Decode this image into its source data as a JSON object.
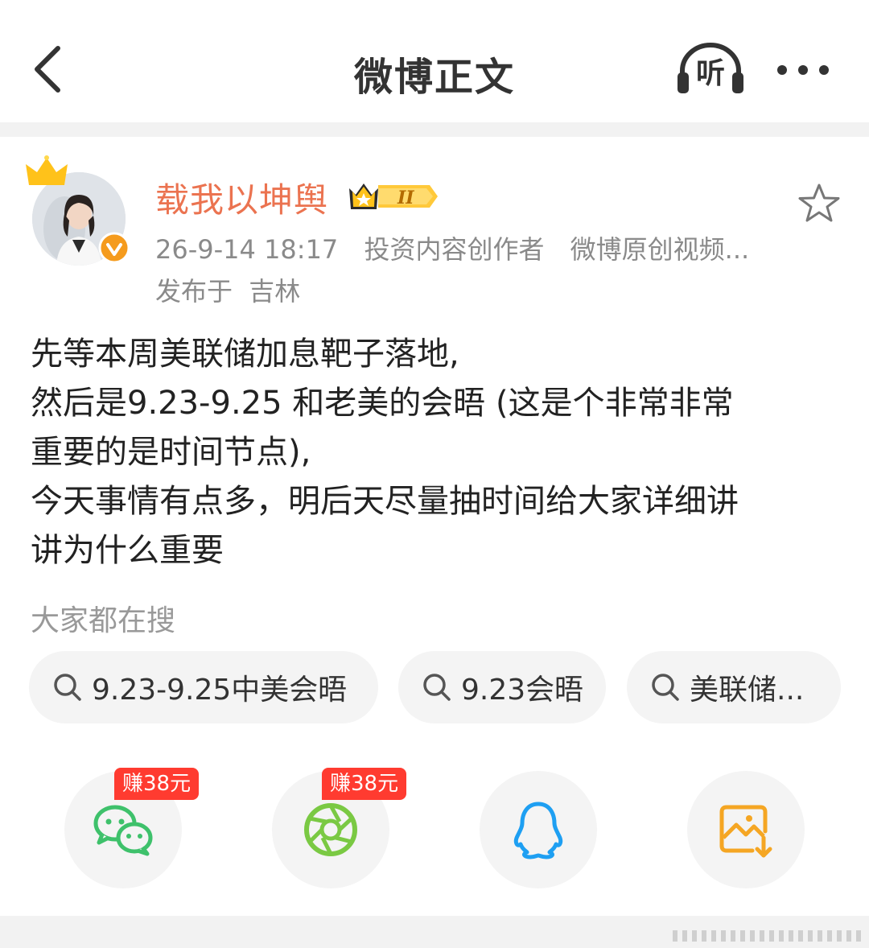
{
  "header": {
    "title": "微博正文",
    "listen_label": "听"
  },
  "post": {
    "author": "载我以坤舆",
    "time": "26-9-14 18:17",
    "tags": [
      "投资内容创作者",
      "微博原创视频..."
    ],
    "location_prefix": "发布于",
    "location": "吉林",
    "content_lines": [
      "先等本周美联储加息靶子落地,",
      "然后是9.23-9.25 和老美的会晤 (这是个非常非常",
      "重要的是时间节点),",
      "今天事情有点多，明后天尽量抽时间给大家详细讲",
      "讲为什么重要"
    ]
  },
  "search": {
    "label": "大家都在搜",
    "chips": [
      "9.23-9.25中美会晤",
      "9.23会晤",
      "美联储..."
    ]
  },
  "share": {
    "reward_label": "赚38元",
    "items": [
      {
        "icon": "wechat-icon",
        "color": "#3ec16b"
      },
      {
        "icon": "moments-icon",
        "color": "#7ac943"
      },
      {
        "icon": "qq-icon",
        "color": "#1e9ff2"
      },
      {
        "icon": "save-image-icon",
        "color": "#f5a623"
      }
    ]
  },
  "colors": {
    "username": "#eb7350",
    "meta": "#8a8a8a",
    "reward_badge": "#ff3b30"
  }
}
